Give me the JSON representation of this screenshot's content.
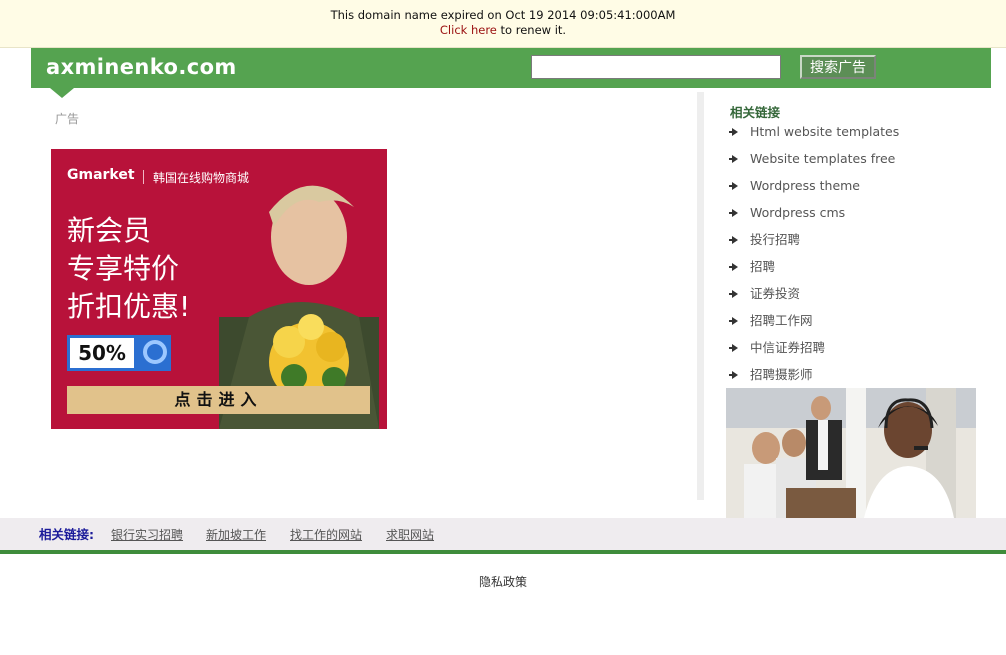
{
  "notice": {
    "expired_text": "This domain name expired on Oct 19 2014 09:05:41:000AM",
    "click_here": "Click here",
    "renew_text": " to renew it."
  },
  "header": {
    "logo": "axminenko.com",
    "search_button": "搜索广告",
    "search_value": ""
  },
  "ad": {
    "label": "广告",
    "brand": "Gmarket",
    "brand_sub": "韩国在线购物商城",
    "slogan_lines": [
      "新会员",
      "专享特价",
      "折扣优惠!"
    ],
    "discount": "50%",
    "cta": "点击进入"
  },
  "sidebar": {
    "title": "相关链接",
    "links": [
      "Html website templates",
      "Website templates free",
      "Wordpress theme",
      "Wordpress cms",
      "投行招聘",
      "招聘",
      "证券投资",
      "招聘工作网",
      "中信证券招聘",
      "招聘摄影师"
    ]
  },
  "bottom": {
    "label": "相关链接:",
    "links": [
      "银行实习招聘",
      "新加坡工作",
      "找工作的网站",
      "求职网站"
    ]
  },
  "footer": {
    "privacy": "隐私政策"
  },
  "colors": {
    "header_green": "#55a350",
    "banner_red": "#b8123a",
    "notice_bg": "#fffce6"
  }
}
